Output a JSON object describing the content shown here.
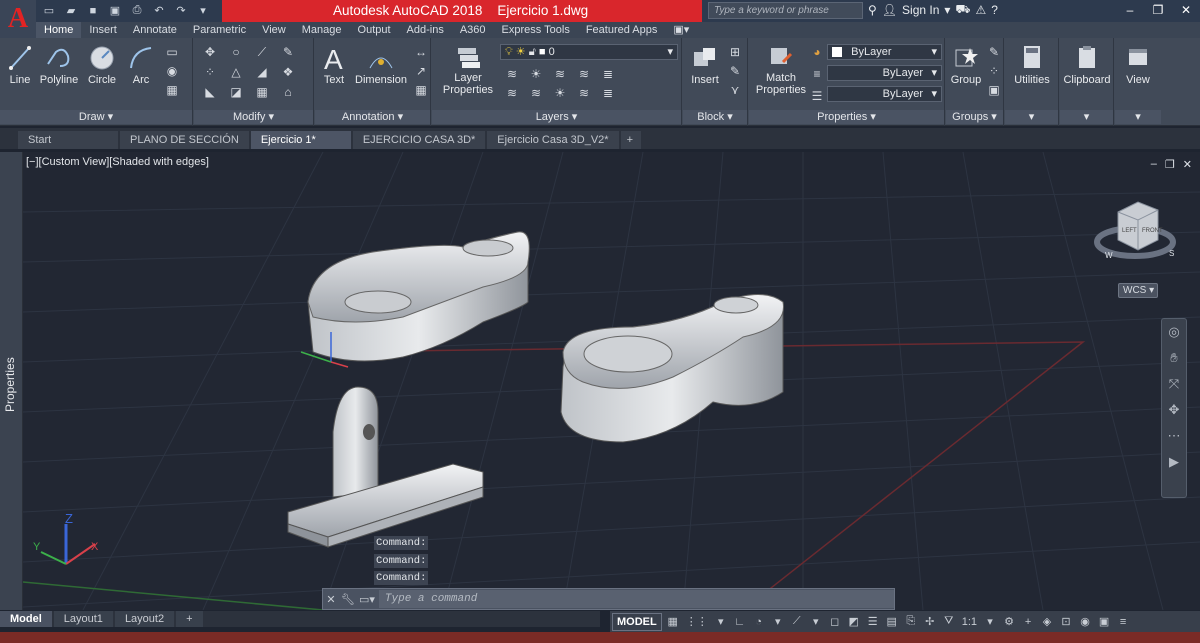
{
  "titlebar": {
    "app_name": "Autodesk AutoCAD 2018",
    "file_name": "Ejercicio 1.dwg",
    "search_placeholder": "Type a keyword or phrase",
    "sign_in": "Sign In"
  },
  "ribbon_tabs": [
    "Home",
    "Insert",
    "Annotate",
    "Parametric",
    "View",
    "Manage",
    "Output",
    "Add-ins",
    "A360",
    "Express Tools",
    "Featured Apps"
  ],
  "panels": {
    "draw": {
      "title": "Draw",
      "buttons": [
        "Line",
        "Polyline",
        "Circle",
        "Arc"
      ]
    },
    "modify": {
      "title": "Modify"
    },
    "annotation": {
      "title": "Annotation",
      "buttons": [
        "Text",
        "Dimension"
      ]
    },
    "layers": {
      "title": "Layers",
      "layer_properties": "Layer Properties",
      "current_layer": "0"
    },
    "block": {
      "title": "Block",
      "insert": "Insert"
    },
    "properties": {
      "title": "Properties",
      "match": "Match Properties",
      "color": "ByLayer",
      "linetype": "ByLayer",
      "lineweight": "ByLayer"
    },
    "groups": {
      "title": "Groups",
      "group": "Group"
    },
    "utilities": "Utilities",
    "clipboard": "Clipboard",
    "view": "View"
  },
  "doc_tabs": [
    "Start",
    "PLANO DE SECCIÓN",
    "Ejercicio 1*",
    "EJERCICIO CASA 3D*",
    "Ejercicio Casa 3D_V2*"
  ],
  "viewport": {
    "label": "[−][Custom View][Shaded with edges]",
    "wcs": "WCS",
    "viewcube_left": "LEFT",
    "viewcube_front": "FRONT",
    "compass_w": "W",
    "compass_s": "S",
    "axis_z": "Z",
    "axis_y": "Y",
    "axis_x": "X"
  },
  "palette": {
    "properties": "Properties"
  },
  "command": {
    "history": [
      "Command:",
      "Command:",
      "Command:"
    ],
    "placeholder": "Type a command"
  },
  "layout_tabs": [
    "Model",
    "Layout1",
    "Layout2"
  ],
  "status": {
    "model": "MODEL",
    "scale": "1:1"
  }
}
